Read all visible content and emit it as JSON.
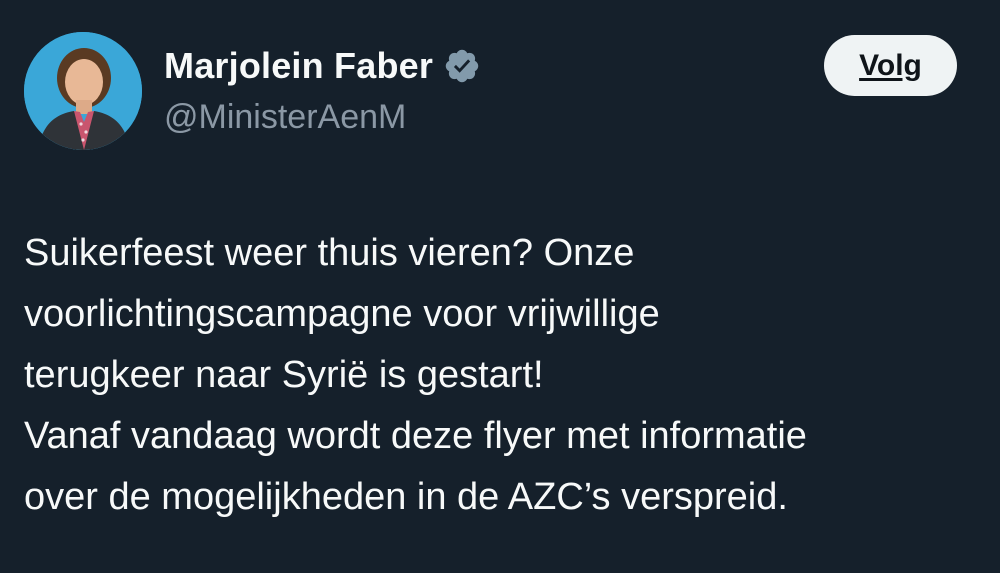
{
  "author": {
    "display_name": "Marjolein Faber",
    "handle": "@MinisterAenM",
    "verified": true,
    "verified_icon": "verified-badge-icon",
    "avatar_icon": "profile-photo"
  },
  "follow_button": {
    "label": "Volg"
  },
  "tweet": {
    "lines": [
      "Suikerfeest weer thuis vieren? Onze",
      "voorlichtingscampagne voor vrijwillige",
      "terugkeer naar Syrië is gestart!",
      "Vanaf vandaag wordt deze flyer met informatie",
      "over de mogelijkheden in de AZC’s verspreid."
    ]
  },
  "colors": {
    "background": "#15202b",
    "text": "#f7f9f9",
    "muted": "#8b98a5",
    "button_bg": "#eff3f4",
    "badge": "#829aab"
  }
}
